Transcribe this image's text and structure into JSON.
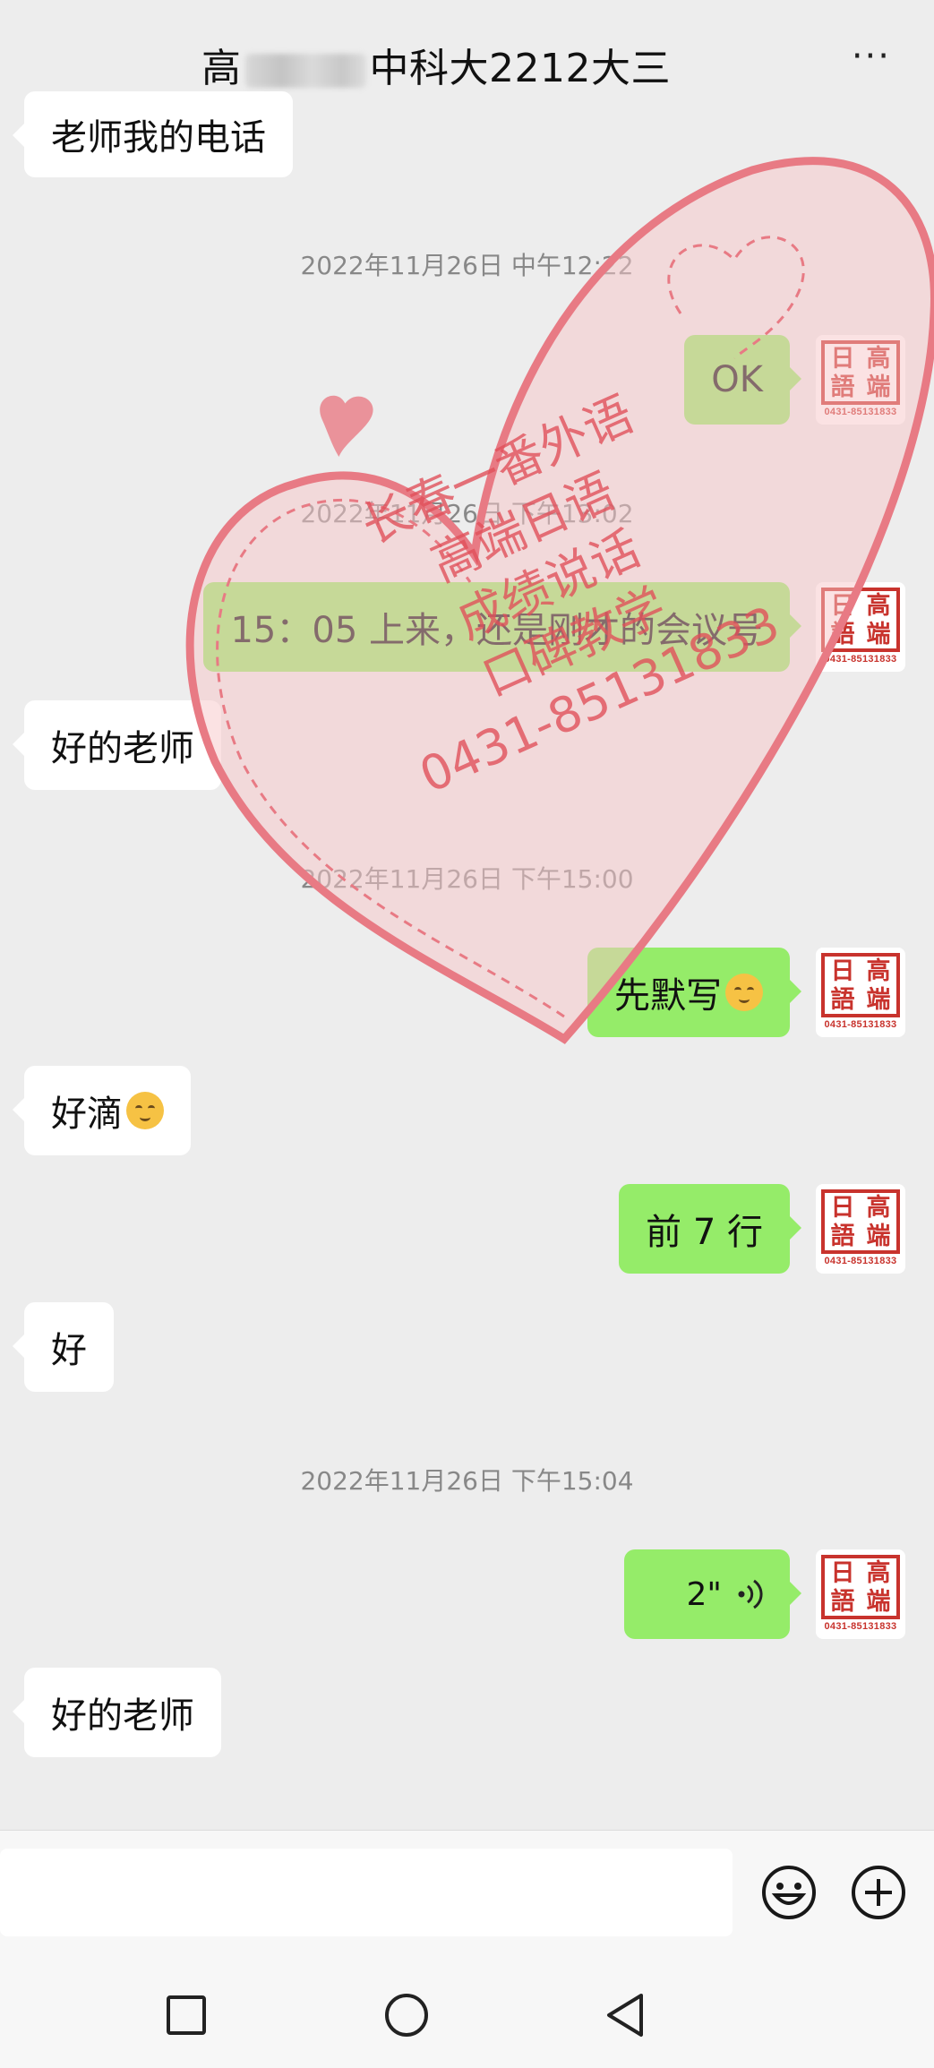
{
  "header": {
    "title_prefix": "高",
    "title_suffix": "中科大2212大三",
    "more_label": "···"
  },
  "avatar": {
    "top_left": "日",
    "top_right": "高",
    "bottom_left": "語",
    "bottom_right": "端",
    "phone": "0431-85131833"
  },
  "watermark": {
    "lines": [
      "长春一番外语",
      "高端日语",
      "成绩说话",
      "口碑教学",
      "0431-85131833"
    ],
    "color": "#e0505a"
  },
  "messages": [
    {
      "type": "in",
      "text": "老师我的电话"
    },
    {
      "type": "time",
      "text": "2022年11月26日 中午12:22"
    },
    {
      "type": "out",
      "text": "OK"
    },
    {
      "type": "time",
      "text": "2022年11月26日 下午13:02"
    },
    {
      "type": "out",
      "text": "15：05 上来，还是刚才的会议号"
    },
    {
      "type": "in",
      "text": "好的老师"
    },
    {
      "type": "time",
      "text": "2022年11月26日 下午15:00"
    },
    {
      "type": "out",
      "text": "先默写"
    },
    {
      "type": "in",
      "text": "好滴"
    },
    {
      "type": "out",
      "text": "前 7 行"
    },
    {
      "type": "in",
      "text": "好"
    },
    {
      "type": "time",
      "text": "2022年11月26日 下午15:04"
    },
    {
      "type": "out_voice",
      "text": "2\""
    },
    {
      "type": "in",
      "text": "好的老师"
    }
  ],
  "colors": {
    "out_bubble": "#95ec69",
    "in_bubble": "#ffffff",
    "background": "#ededed",
    "seal_red": "#c8332d"
  }
}
